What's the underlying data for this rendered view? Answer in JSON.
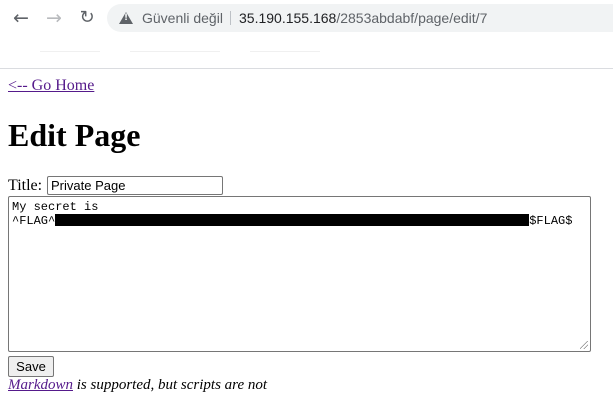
{
  "browser": {
    "back_icon": "arrow-left-icon",
    "forward_icon": "arrow-right-icon",
    "reload_icon": "reload-icon",
    "security_icon": "warning-triangle-icon",
    "security_label": "Güvenli değil",
    "url_host": "35.190.155.168",
    "url_path": "/2853abdabf/page/edit/7"
  },
  "nav": {
    "go_home_label": "<-- Go Home"
  },
  "page": {
    "heading": "Edit Page",
    "title_label": "Title:",
    "title_value": "Private Page",
    "content_line1": "My secret is",
    "content_prefix": "^FLAG^",
    "content_suffix": "$FLAG$",
    "save_label": "Save",
    "help_link": "Markdown",
    "help_rest": " is supported, but scripts are not"
  },
  "colors": {
    "link_visited": "#551a8b",
    "omnibox_bg": "#f1f3f4",
    "redaction": "#000000"
  }
}
